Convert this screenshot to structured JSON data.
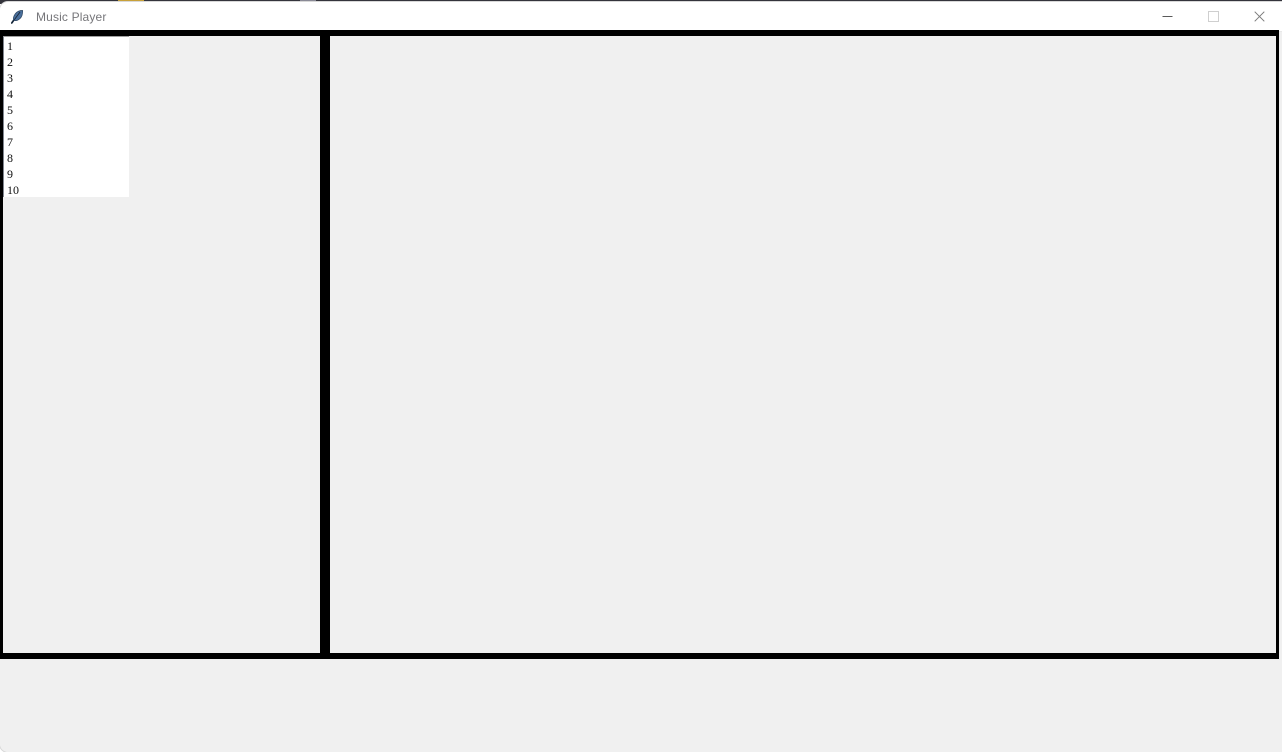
{
  "window": {
    "title": "Music Player",
    "icon": "feather-icon",
    "controls": {
      "minimize": "minimize-icon",
      "maximize": "maximize-icon",
      "close": "close-icon"
    }
  },
  "colors": {
    "window_background": "#f0f0f0",
    "title_bar_background": "#ffffff",
    "title_text": "#76767a",
    "frame_border": "#000000",
    "listbox_background": "#ffffff",
    "listbox_text": "#111111",
    "desktop_strip": "#34343c"
  },
  "left_pane": {
    "playlist": {
      "name": "playlist-listbox",
      "items": [
        "1",
        "2",
        "3",
        "4",
        "5",
        "6",
        "7",
        "8",
        "9",
        "10"
      ]
    }
  },
  "right_pane": {
    "content": ""
  },
  "bottom_area": {
    "content": ""
  }
}
